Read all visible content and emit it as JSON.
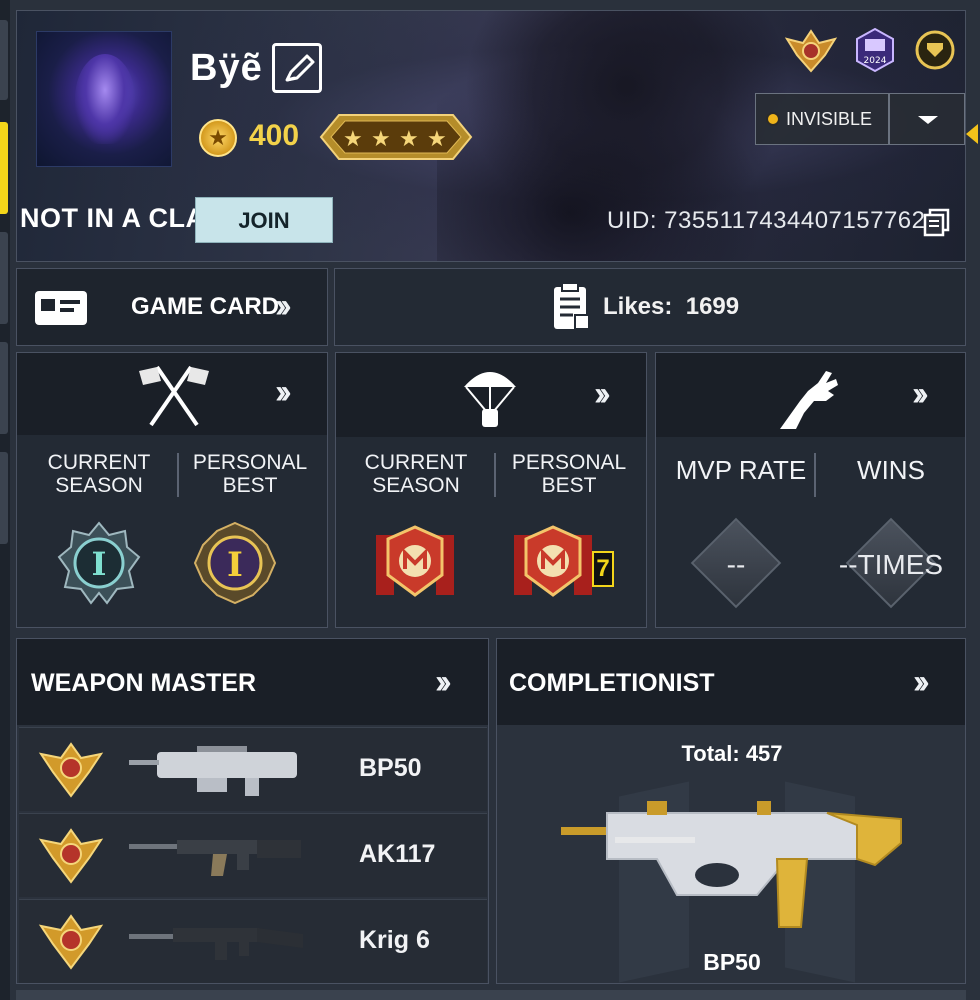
{
  "profile": {
    "username": "Bÿẽ",
    "currency_value": "400",
    "clan_status": "NOT IN A CLAN",
    "join_label": "JOIN",
    "uid_text": "UID: 7355117434407157762",
    "visibility_label": "INVISIBLE",
    "year_badge": "2024",
    "rank_stars": 4
  },
  "game_card": {
    "label": "GAME CARD"
  },
  "likes": {
    "label": "Likes:",
    "value": "1699"
  },
  "mp_ranked": {
    "current_label": "CURRENT\nSEASON",
    "best_label": "PERSONAL\nBEST",
    "current_rank": "I",
    "best_rank": "I"
  },
  "br_ranked": {
    "current_label": "CURRENT\nSEASON",
    "best_label": "PERSONAL\nBEST",
    "best_count": "7"
  },
  "zombies": {
    "mvp_label": "MVP RATE",
    "wins_label": "WINS",
    "mvp_value": "--",
    "wins_value": "--TIMES"
  },
  "weapon_master": {
    "title": "WEAPON MASTER",
    "weapons": [
      {
        "name": "BP50"
      },
      {
        "name": "AK117"
      },
      {
        "name": "Krig 6"
      }
    ]
  },
  "completionist": {
    "title": "COMPLETIONIST",
    "total": "Total: 457",
    "weapon": "BP50"
  },
  "colors": {
    "accent_yellow": "#f3d51a",
    "join_bg": "#c8e4ea",
    "coin_gold": "#f3d24a"
  }
}
